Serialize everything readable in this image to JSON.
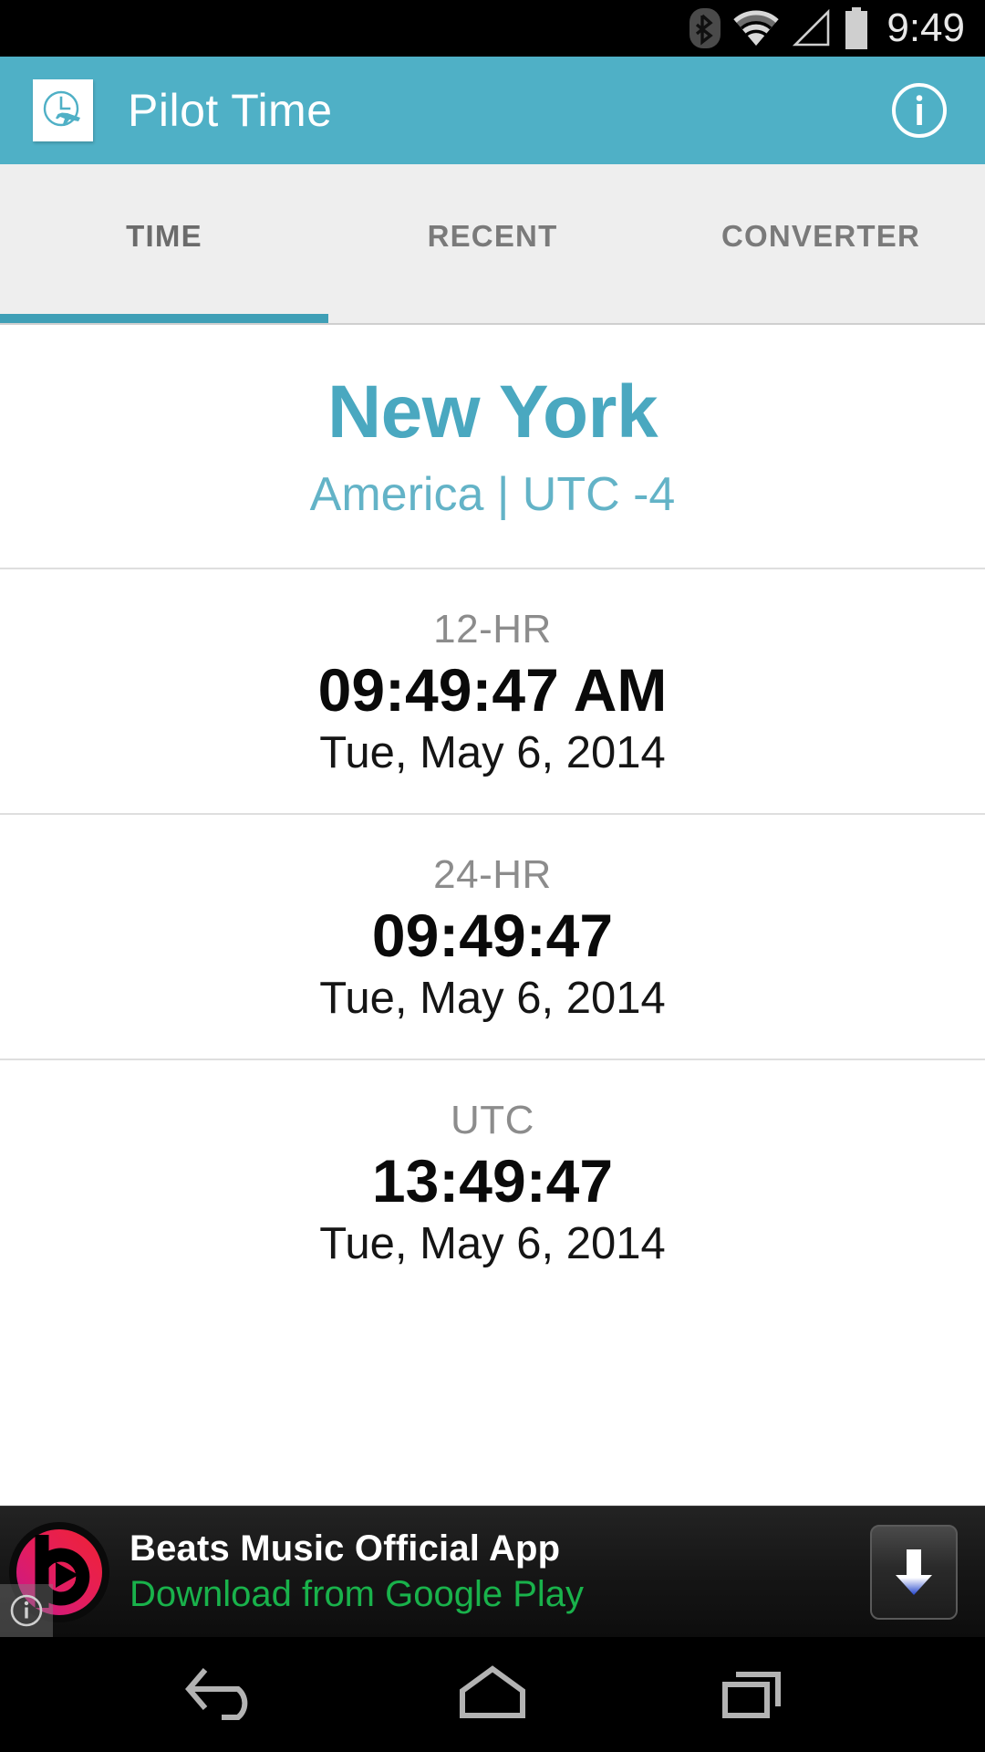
{
  "status_bar": {
    "clock": "9:49",
    "icons": [
      "bluetooth-icon",
      "wifi-icon",
      "cell-signal-icon",
      "battery-icon"
    ]
  },
  "app_bar": {
    "title": "Pilot Time",
    "app_icon": "clock-airplane-icon",
    "info_icon": "info-icon",
    "background_color": "#4fb0c6"
  },
  "tabs": {
    "items": [
      {
        "label": "TIME",
        "active": true
      },
      {
        "label": "RECENT",
        "active": false
      },
      {
        "label": "CONVERTER",
        "active": false
      }
    ],
    "indicator_color": "#3f9fb6"
  },
  "city": {
    "name": "New York",
    "subtitle": "America | UTC -4",
    "name_color": "#4aa8c0",
    "subtitle_color": "#63b3c7"
  },
  "time_blocks": [
    {
      "label": "12-HR",
      "time": "09:49:47 AM",
      "date": "Tue, May 6, 2014"
    },
    {
      "label": "24-HR",
      "time": "09:49:47",
      "date": "Tue, May 6, 2014"
    },
    {
      "label": "UTC",
      "time": "13:49:47",
      "date": "Tue, May 6, 2014"
    }
  ],
  "ad": {
    "title": "Beats Music Official App",
    "subtitle": "Download from Google Play",
    "subtitle_color": "#19b24b",
    "logo": "beats-logo-icon",
    "download_icon": "download-arrow-icon",
    "info_badge": "ad-info-icon"
  },
  "nav_bar": {
    "back": "back-icon",
    "home": "home-icon",
    "recents": "recents-icon"
  }
}
